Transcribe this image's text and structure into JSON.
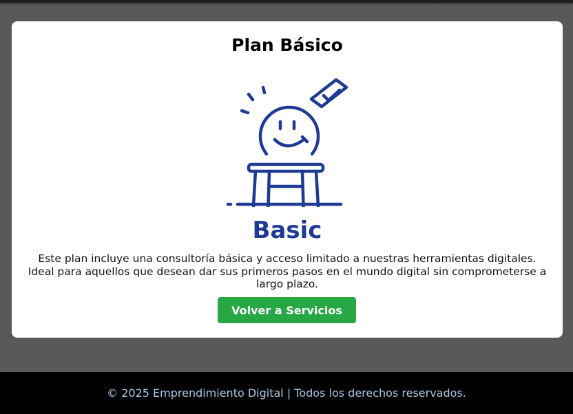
{
  "card": {
    "title": "Plan Básico",
    "illustration": "smiling-person-on-stool-with-checkmark",
    "badge_text": "Basic",
    "description": "Este plan incluye una consultoría básica y acceso limitado a nuestras herramientas digitales. Ideal para aquellos que desean dar sus primeros pasos en el mundo digital sin comprometerse a largo plazo.",
    "back_button_label": "Volver a Servicios"
  },
  "footer": {
    "text": "© 2025 Emprendimiento Digital | Todos los derechos reservados."
  },
  "colors": {
    "page_background": "#595959",
    "card_background": "#ffffff",
    "illustration_blue": "#1f3a93",
    "button_green": "#28a745",
    "footer_background": "#000000",
    "footer_text": "#a9c8e6"
  }
}
